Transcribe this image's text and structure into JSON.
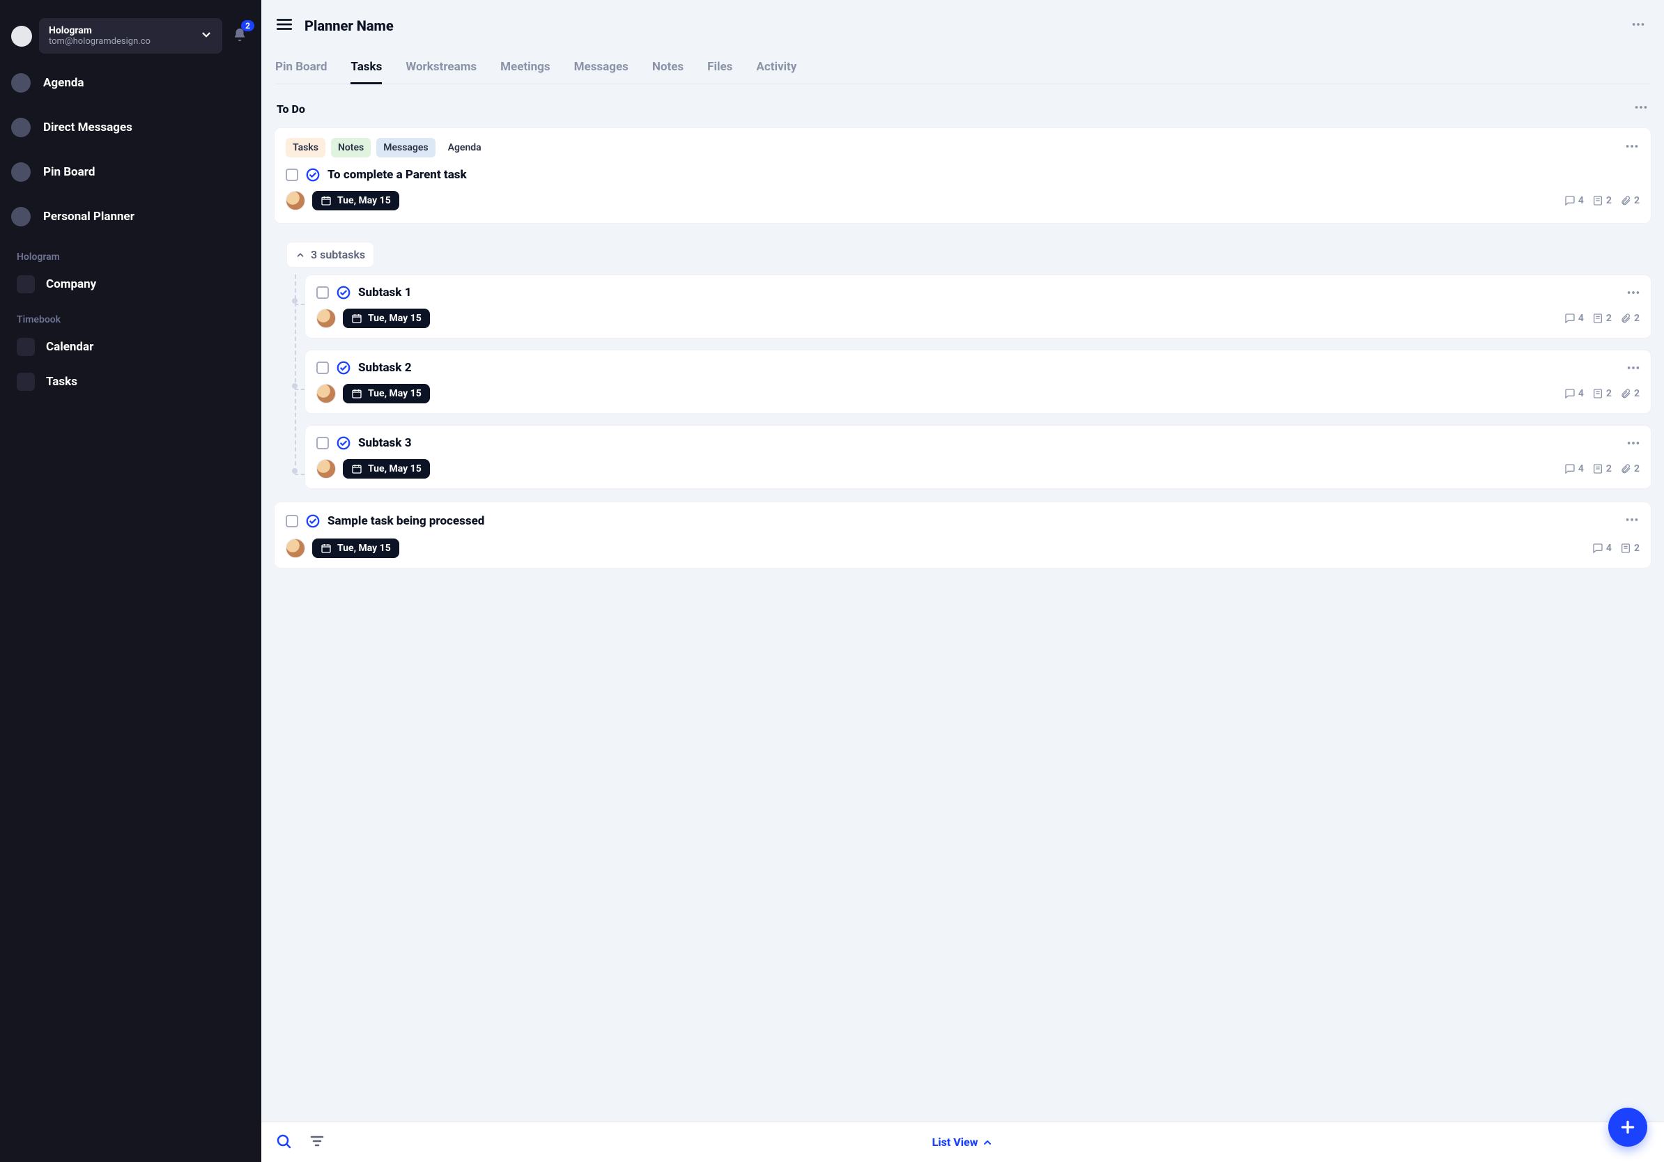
{
  "sidebar": {
    "workspace": {
      "name": "Hologram",
      "email": "tom@hologramdesign.co"
    },
    "notification_badge": "2",
    "nav": [
      {
        "label": "Agenda"
      },
      {
        "label": "Direct Messages"
      },
      {
        "label": "Pin Board"
      },
      {
        "label": "Personal Planner"
      }
    ],
    "sections": [
      {
        "label": "Hologram",
        "items": [
          {
            "label": "Company"
          }
        ]
      },
      {
        "label": "Timebook",
        "items": [
          {
            "label": "Calendar"
          },
          {
            "label": "Tasks"
          }
        ]
      }
    ]
  },
  "header": {
    "title": "Planner Name",
    "tabs": [
      {
        "label": "Pin Board",
        "active": false
      },
      {
        "label": "Tasks",
        "active": true
      },
      {
        "label": "Workstreams",
        "active": false
      },
      {
        "label": "Meetings",
        "active": false
      },
      {
        "label": "Messages",
        "active": false
      },
      {
        "label": "Notes",
        "active": false
      },
      {
        "label": "Files",
        "active": false
      },
      {
        "label": "Activity",
        "active": false
      }
    ]
  },
  "section": {
    "title": "To Do"
  },
  "task1": {
    "tags": {
      "t1": "Tasks",
      "t2": "Notes",
      "t3": "Messages",
      "t4": "Agenda"
    },
    "title": "To complete a Parent task",
    "date": "Tue, May 15",
    "counts": {
      "comments": "4",
      "notes": "2",
      "attachments": "2"
    },
    "subtasks_toggle": "3 subtasks",
    "subtasks": [
      {
        "title": "Subtask 1",
        "date": "Tue, May 15",
        "counts": {
          "comments": "4",
          "notes": "2",
          "attachments": "2"
        }
      },
      {
        "title": "Subtask 2",
        "date": "Tue, May 15",
        "counts": {
          "comments": "4",
          "notes": "2",
          "attachments": "2"
        }
      },
      {
        "title": "Subtask 3",
        "date": "Tue, May 15",
        "counts": {
          "comments": "4",
          "notes": "2",
          "attachments": "2"
        }
      }
    ]
  },
  "task2": {
    "title": "Sample task being processed",
    "date": "Tue, May 15",
    "counts": {
      "comments": "4",
      "notes": "2"
    }
  },
  "bottombar": {
    "view_label": "List View"
  }
}
